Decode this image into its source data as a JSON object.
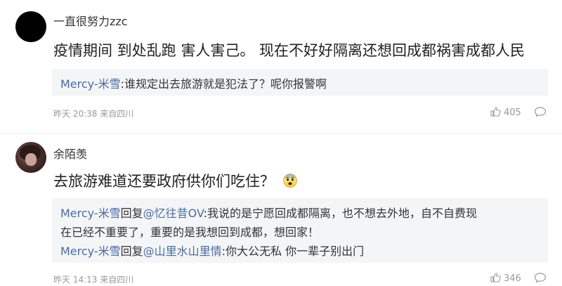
{
  "comments": [
    {
      "username": "一直很努力zzc",
      "body": "疫情期间 到处乱跑 害人害己。 现在不好好隔离还想回成都祸害成都人民",
      "replies": [
        {
          "author": "Mercy-米雪",
          "text": ":谁规定出去旅游就是犯法了？呢你报警啊"
        }
      ],
      "meta": "昨天 20:38 来自四川",
      "likes": "405"
    },
    {
      "username": "余陌羡",
      "body": "去旅游难道还要政府供你们吃住？",
      "replies": [
        {
          "author": "Mercy-米雪",
          "action": "回复",
          "mention": "@忆往昔OV",
          "text_line1": ":我说的是宁愿回成都隔离，也不想去外地，自不自费现",
          "text_line2": "在已经不重要了，重要的是我想回到成都，想回家！"
        },
        {
          "author": "Mercy-米雪",
          "action": "回复",
          "mention": "@山里水山里情",
          "text": ":你大公无私 你一辈子别出门"
        }
      ],
      "meta": "昨天 14:13 来自四川",
      "likes": "346"
    }
  ],
  "icons": {
    "like": "thumbs-up-icon",
    "reply": "comment-bubble-icon",
    "emoji": "fearful-face-emoji"
  },
  "colors": {
    "link": "#4a6b9f",
    "meta": "#999999",
    "reply_bg": "#f4f5f7"
  }
}
